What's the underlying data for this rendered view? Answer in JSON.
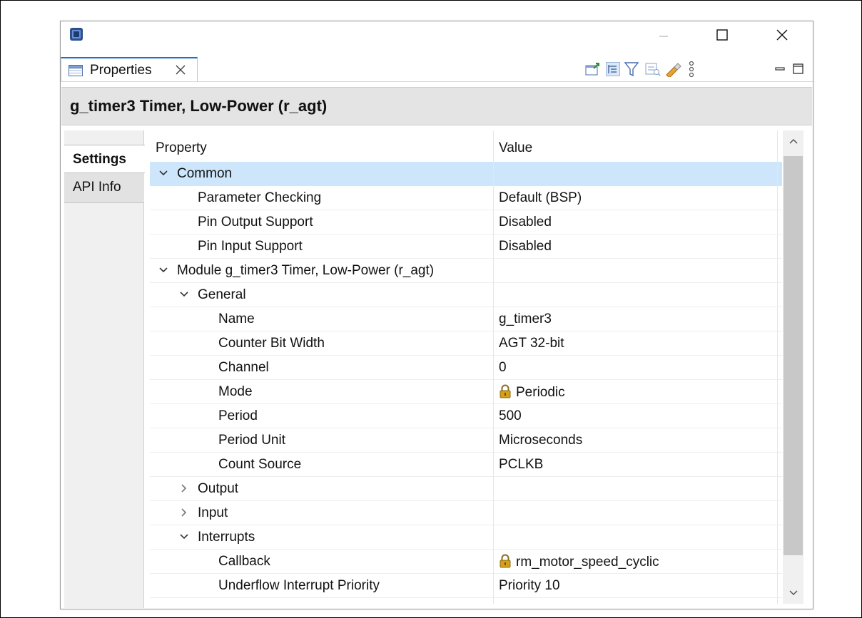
{
  "window": {
    "tab_label": "Properties"
  },
  "header": {
    "title": "g_timer3 Timer, Low-Power (r_agt)"
  },
  "side_tabs": {
    "settings": "Settings",
    "api_info": "API Info"
  },
  "columns": {
    "property": "Property",
    "value": "Value"
  },
  "rows": [
    {
      "name": "Common",
      "value": "",
      "level": 0,
      "expander": "expanded",
      "selected": true
    },
    {
      "name": "Parameter Checking",
      "value": "Default (BSP)",
      "level": 1,
      "expander": "none"
    },
    {
      "name": "Pin Output Support",
      "value": "Disabled",
      "level": 1,
      "expander": "none"
    },
    {
      "name": "Pin Input Support",
      "value": "Disabled",
      "level": 1,
      "expander": "none"
    },
    {
      "name": "Module g_timer3 Timer, Low-Power (r_agt)",
      "value": "",
      "level": 0,
      "expander": "expanded"
    },
    {
      "name": "General",
      "value": "",
      "level": 1,
      "expander": "expanded"
    },
    {
      "name": "Name",
      "value": "g_timer3",
      "level": 2,
      "expander": "none"
    },
    {
      "name": "Counter Bit Width",
      "value": "AGT 32-bit",
      "level": 2,
      "expander": "none"
    },
    {
      "name": "Channel",
      "value": "0",
      "level": 2,
      "expander": "none"
    },
    {
      "name": "Mode",
      "value": "Periodic",
      "level": 2,
      "expander": "none",
      "locked": true
    },
    {
      "name": "Period",
      "value": "500",
      "level": 2,
      "expander": "none"
    },
    {
      "name": "Period Unit",
      "value": "Microseconds",
      "level": 2,
      "expander": "none"
    },
    {
      "name": "Count Source",
      "value": "PCLKB",
      "level": 2,
      "expander": "none"
    },
    {
      "name": "Output",
      "value": "",
      "level": 1,
      "expander": "collapsed"
    },
    {
      "name": "Input",
      "value": "",
      "level": 1,
      "expander": "collapsed"
    },
    {
      "name": "Interrupts",
      "value": "",
      "level": 1,
      "expander": "expanded"
    },
    {
      "name": "Callback",
      "value": "rm_motor_speed_cyclic",
      "level": 2,
      "expander": "none",
      "locked": true
    },
    {
      "name": "Underflow Interrupt Priority",
      "value": "Priority 10",
      "level": 2,
      "expander": "none"
    }
  ],
  "icons": {
    "toolbar": [
      "pin-to-selection-icon",
      "show-categories-icon",
      "filter-icon",
      "advanced-properties-icon",
      "restore-default-icon",
      "view-menu-icon"
    ],
    "view": [
      "minimize-view-icon",
      "maximize-view-icon"
    ]
  },
  "colors": {
    "selection": "#cde6fb",
    "active_tab": "#1d6fd2",
    "header_bg": "#e4e4e4",
    "lock": "#d4a017"
  }
}
